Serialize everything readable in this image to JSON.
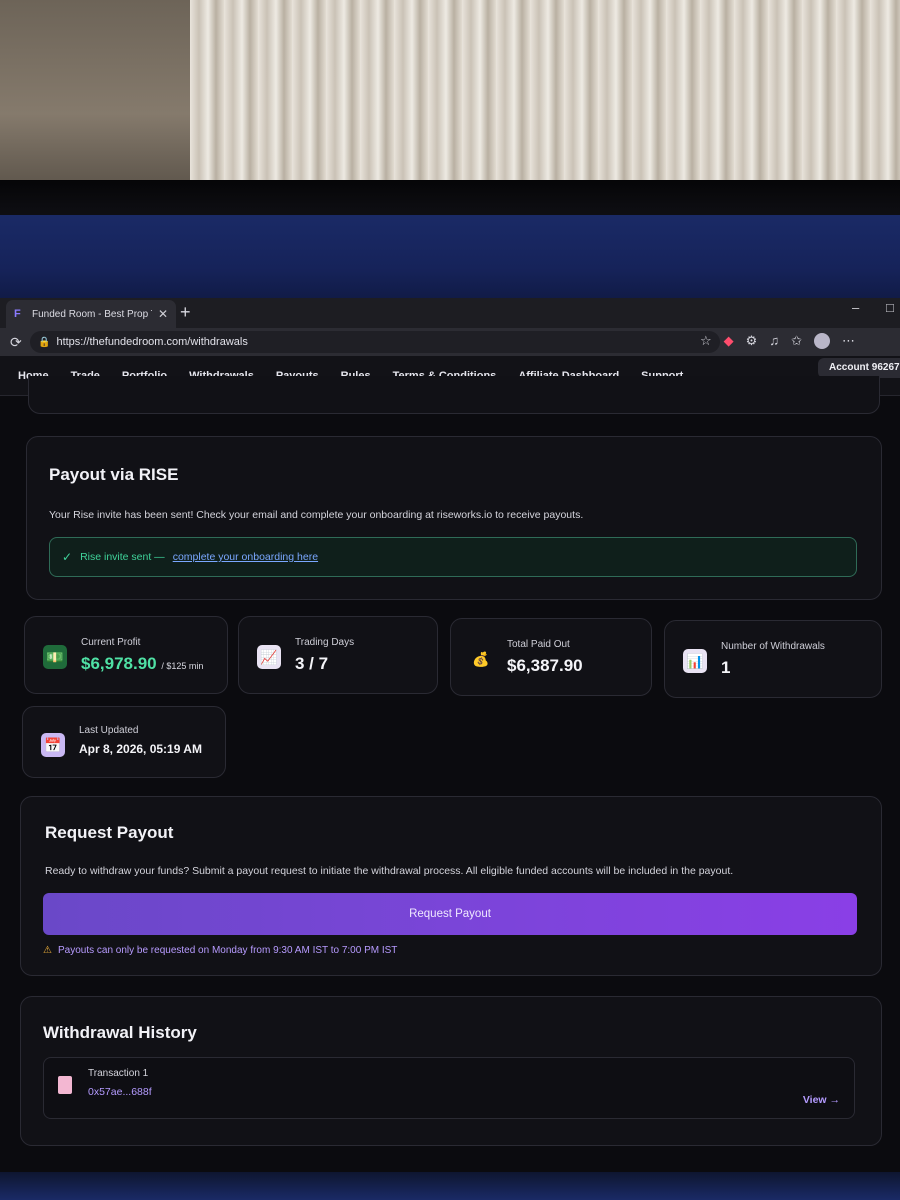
{
  "browser": {
    "tab_title": "Funded Room - Best Prop Trading",
    "tab_close": "✕",
    "new_tab": "+",
    "url": "https://thefundedroom.com/withdrawals",
    "window_minimize": "–",
    "window_maximize": "□"
  },
  "nav": {
    "items": [
      "Home",
      "Trade",
      "Portfolio",
      "Withdrawals",
      "Payouts",
      "Rules",
      "Terms & Conditions",
      "Affiliate Dashboard",
      "Support"
    ],
    "active": "Withdrawals",
    "account_label": "Account 96267"
  },
  "rise": {
    "title": "Payout via RISE",
    "description": "Your Rise invite has been sent! Check your email and complete your onboarding at riseworks.io to receive payouts.",
    "notice_text": "Rise invite sent —",
    "notice_link": "complete your onboarding here"
  },
  "stats": {
    "current_profit": {
      "label": "Current Profit",
      "value": "$6,978.90",
      "sub": "/ $125 min"
    },
    "trading_days": {
      "label": "Trading Days",
      "value": "3 / 7"
    },
    "total_paid_out": {
      "label": "Total Paid Out",
      "value": "$6,387.90"
    },
    "withdrawals": {
      "label": "Number of Withdrawals",
      "value": "1"
    },
    "last_updated": {
      "label": "Last Updated",
      "value": "Apr 8, 2026, 05:19 AM"
    }
  },
  "request_payout": {
    "title": "Request Payout",
    "description": "Ready to withdraw your funds? Submit a payout request to initiate the withdrawal process. All eligible funded accounts will be included in the payout.",
    "button_label": "Request Payout",
    "warning": "Payouts can only be requested on Monday from 9:30 AM IST to 7:00 PM IST"
  },
  "history": {
    "title": "Withdrawal History",
    "transactions": [
      {
        "label": "Transaction 1",
        "hash": "0x57ae...688f",
        "action": "View →"
      }
    ]
  },
  "icons": {
    "profit": "money-icon",
    "trading_days": "chart-up-icon",
    "paid_out": "money-bag-icon",
    "withdrawals": "bar-chart-icon",
    "updated": "calendar-icon",
    "warning": "warning-icon"
  },
  "colors": {
    "accent_purple": "#7a45d8",
    "success_green": "#4fe0a4",
    "link_blue": "#7aa7ff",
    "warning_amber": "#f0b23a"
  }
}
